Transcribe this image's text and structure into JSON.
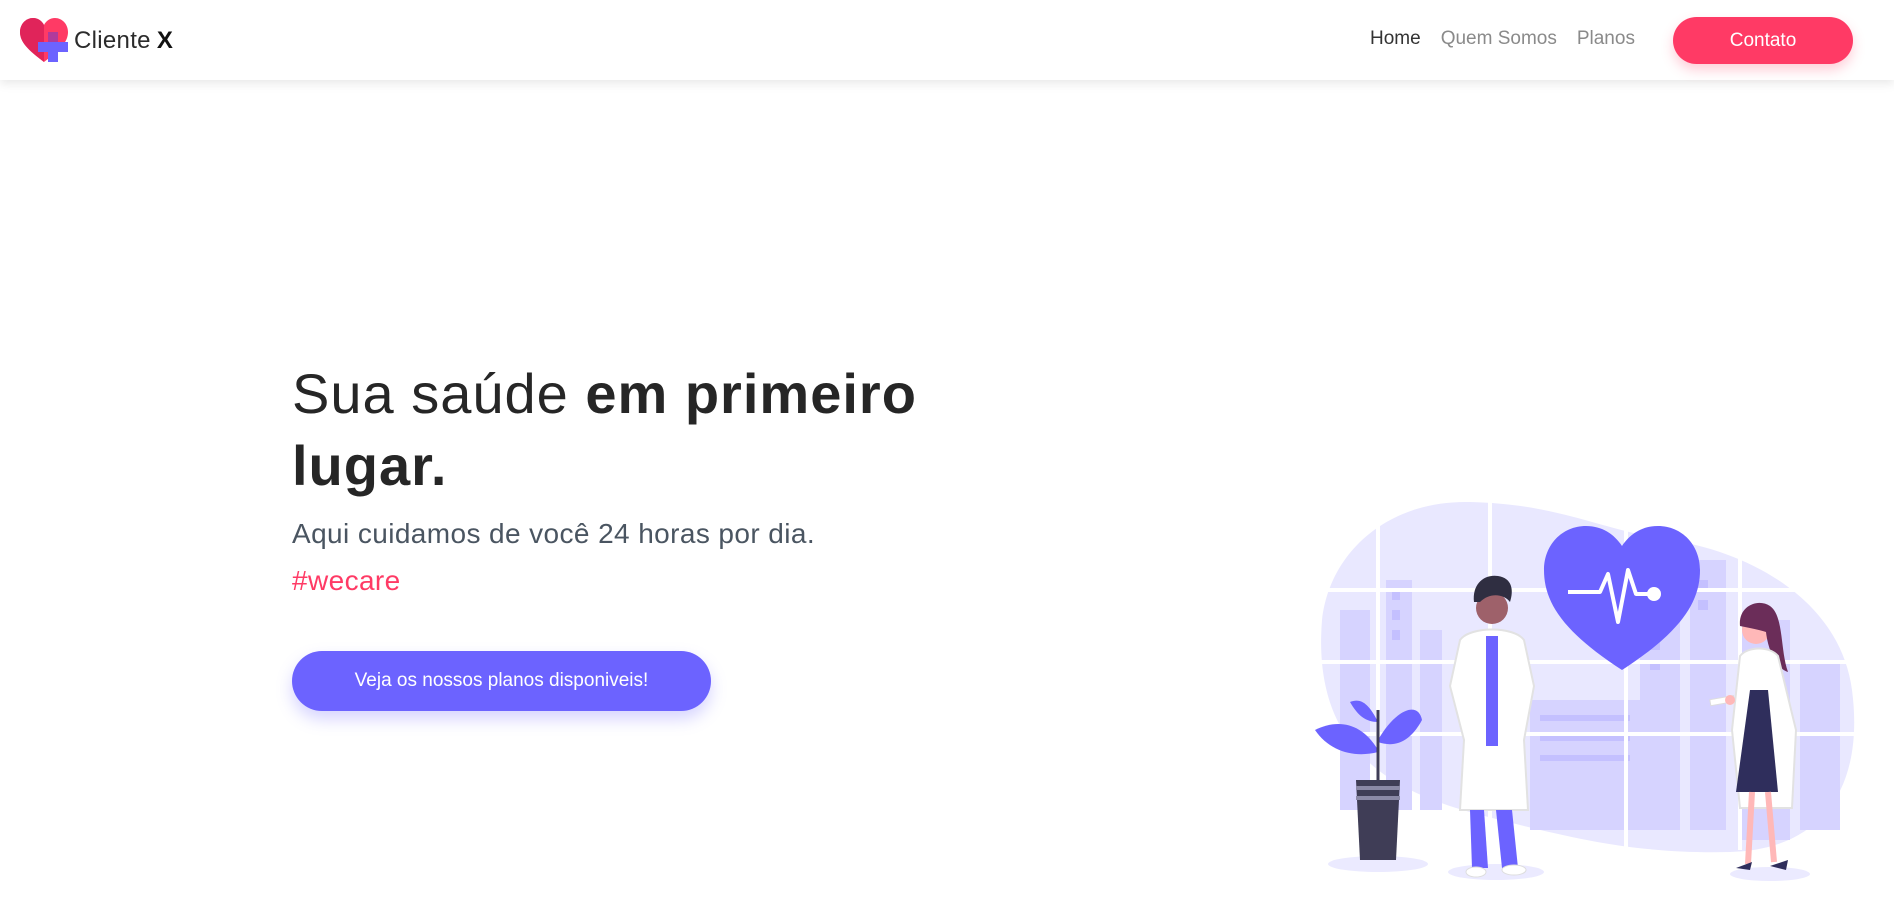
{
  "brand": {
    "name": "Cliente",
    "name_suffix": "X",
    "logo_icon": "heart-plus-icon",
    "logo_colors": [
      "#ff3a65",
      "#c2185b",
      "#6c63ff"
    ]
  },
  "nav": {
    "items": [
      {
        "label": "Home"
      },
      {
        "label": "Quem Somos"
      },
      {
        "label": "Planos"
      }
    ],
    "cta_label": "Contato"
  },
  "hero": {
    "title_regular": "Sua saúde ",
    "title_bold": "em primeiro lugar.",
    "subtitle": "Aqui cuidamos de você 24 horas por dia.",
    "hashtag": "#wecare",
    "button_label": "Veja os nossos planos disponiveis!"
  },
  "illustration": {
    "icon": "doctors-heartbeat-illustration"
  },
  "colors": {
    "accent_pink": "#ff3a65",
    "accent_purple": "#6c63ff",
    "text_dark": "#262626",
    "text_muted": "#4a5561"
  }
}
